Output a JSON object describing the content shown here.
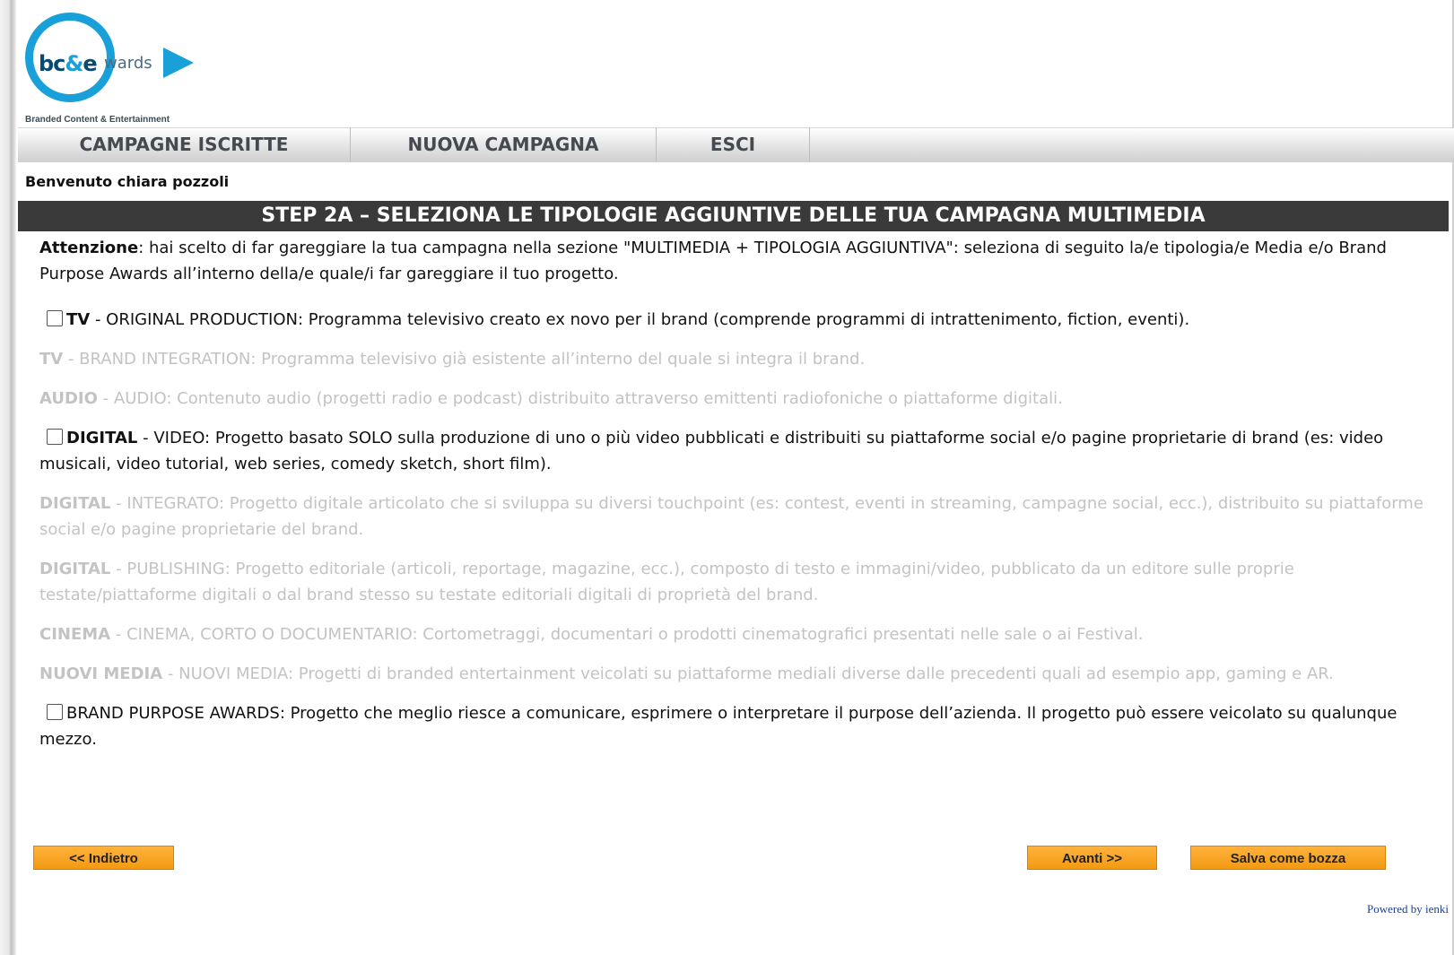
{
  "header": {
    "logo_core_a": "bc",
    "logo_core_amp": "&",
    "logo_core_b": "e",
    "logo_suffix": "wards",
    "logo_subtitle": "Branded Content & Entertainment",
    "accent_color": "#1aa0d8"
  },
  "nav": {
    "items": [
      {
        "label": "CAMPAGNE ISCRITTE"
      },
      {
        "label": "NUOVA CAMPAGNA"
      },
      {
        "label": "ESCI"
      }
    ]
  },
  "welcome": "Benvenuto chiara pozzoli",
  "step_title": "STEP 2A – SELEZIONA LE TIPOLOGIE AGGIUNTIVE DELLE TUA CAMPAGNA MULTIMEDIA",
  "intro": {
    "strong": "Attenzione",
    "text": ": hai scelto di far gareggiare la tua campagna nella sezione \"MULTIMEDIA + TIPOLOGIA AGGIUNTIVA\": seleziona di seguito la/e tipologia/e Media e/o Brand Purpose Awards all’interno della/e quale/i far gareggiare il tuo progetto."
  },
  "options": [
    {
      "category": "TV",
      "text": " - ORIGINAL PRODUCTION: Programma televisivo creato ex novo per il brand (comprende programmi di intrattenimento, fiction, eventi).",
      "enabled": true,
      "checked": false
    },
    {
      "category": "TV",
      "text": " - BRAND INTEGRATION: Programma televisivo già esistente all’interno del quale si integra il brand.",
      "enabled": false
    },
    {
      "category": "AUDIO",
      "text": " - AUDIO: Contenuto audio (progetti radio e podcast) distribuito attraverso emittenti radiofoniche o piattaforme digitali.",
      "enabled": false
    },
    {
      "category": "DIGITAL",
      "text": " - VIDEO: Progetto basato SOLO sulla produzione di uno o più video pubblicati e distribuiti su piattaforme social e/o pagine proprietarie di brand (es: video musicali, video tutorial, web series, comedy sketch, short film).",
      "enabled": true,
      "checked": false
    },
    {
      "category": "DIGITAL",
      "text": " - INTEGRATO: Progetto digitale articolato che si sviluppa su diversi touchpoint (es: contest, eventi in streaming, campagne social, ecc.), distribuito su piattaforme social e/o pagine proprietarie del brand.",
      "enabled": false
    },
    {
      "category": "DIGITAL",
      "text": " - PUBLISHING: Progetto editoriale (articoli, reportage, magazine, ecc.), composto di testo e immagini/video, pubblicato da un editore sulle proprie testate/piattaforme digitali o dal brand stesso su testate editoriali digitali di proprietà del brand.",
      "enabled": false
    },
    {
      "category": "CINEMA",
      "text": " - CINEMA, CORTO O DOCUMENTARIO: Cortometraggi, documentari o prodotti cinematografici presentati nelle sale o ai Festival.",
      "enabled": false
    },
    {
      "category": "NUOVI MEDIA",
      "text": " - NUOVI MEDIA: Progetti di branded entertainment veicolati su piattaforme mediali diverse dalle precedenti quali ad esempio app, gaming e AR.",
      "enabled": false
    },
    {
      "category": "",
      "text": "BRAND PURPOSE AWARDS: Progetto che meglio riesce a comunicare, esprimere o interpretare il purpose dell’azienda. Il progetto può essere veicolato su qualunque mezzo.",
      "enabled": true,
      "checked": false
    }
  ],
  "buttons": {
    "back": "<< Indietro",
    "next": "Avanti >>",
    "save": "Salva come bozza",
    "color": "#f9a629"
  },
  "footer": {
    "powered": "Powered by ienki"
  }
}
